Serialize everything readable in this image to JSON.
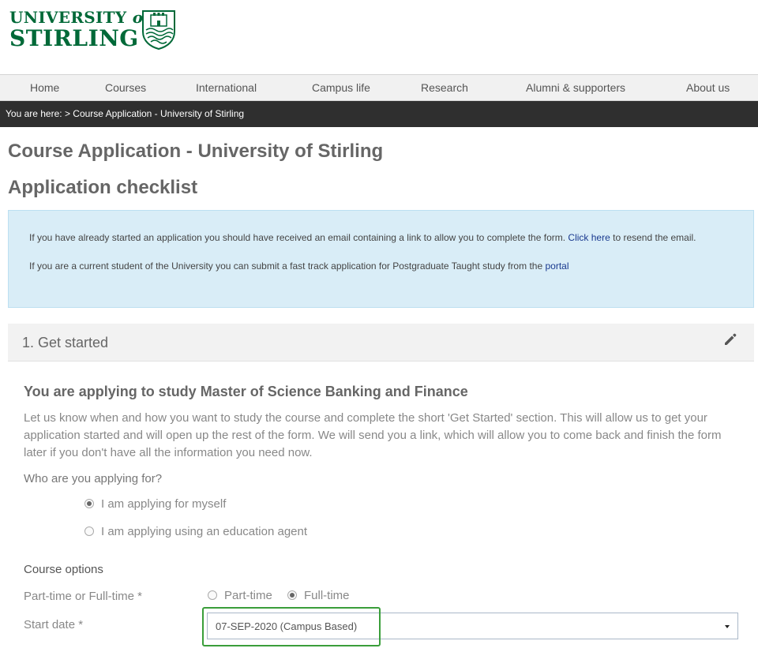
{
  "logo": {
    "line1": "UNIVERSITY",
    "line1_of": "of",
    "line2": "STIRLING"
  },
  "nav": {
    "items": [
      {
        "label": "Home"
      },
      {
        "label": "Courses"
      },
      {
        "label": "International"
      },
      {
        "label": "Campus life"
      },
      {
        "label": "Research"
      },
      {
        "label": "Alumni & supporters"
      },
      {
        "label": "About us"
      }
    ]
  },
  "breadcrumb": {
    "text": "You are here: > Course Application - University of Stirling"
  },
  "page": {
    "title": "Course Application - University of Stirling",
    "checklist_title": "Application checklist"
  },
  "info": {
    "line1_text": "If you have already started an application you should have received an email containing a link to allow you to complete the form.",
    "line1_link": "Click here",
    "line1_tail": "to resend the email.",
    "line2_text": "If you are a current student of the University you can submit a fast track application for Postgraduate Taught study from the",
    "line2_link": "portal"
  },
  "section": {
    "title": "1. Get started",
    "edit_icon": "pencil-icon"
  },
  "content": {
    "heading": "You are applying to study Master of Science Banking and Finance",
    "intro": "Let us know when and how you want to study the course and complete the short 'Get Started' section. This will allow us to get your application started and will open up the rest of the form. We will send you a link, which will allow you to come back and finish the form later if you don't have all the information you need now.",
    "who_label": "Who are you applying for?",
    "who_options": [
      {
        "label": "I am applying for myself",
        "checked": true
      },
      {
        "label": "I am applying using an education agent",
        "checked": false
      }
    ],
    "course_options_heading": "Course options",
    "mode_label": "Part-time or Full-time *",
    "mode_options": [
      {
        "label": "Part-time",
        "checked": false
      },
      {
        "label": "Full-time",
        "checked": true
      }
    ],
    "start_date_label": "Start date *",
    "start_date_value": "07-SEP-2020 (Campus Based)"
  },
  "colors": {
    "brand_green": "#006938",
    "breadcrumb_bg": "#2f2f2f",
    "info_bg": "#d9edf7",
    "highlight": "#3a9e3a"
  }
}
